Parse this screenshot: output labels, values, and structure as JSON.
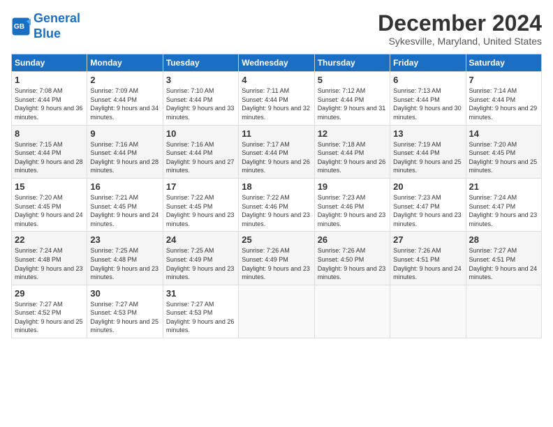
{
  "header": {
    "logo_line1": "General",
    "logo_line2": "Blue",
    "title": "December 2024",
    "subtitle": "Sykesville, Maryland, United States"
  },
  "columns": [
    "Sunday",
    "Monday",
    "Tuesday",
    "Wednesday",
    "Thursday",
    "Friday",
    "Saturday"
  ],
  "weeks": [
    [
      {
        "day": "1",
        "rise": "Sunrise: 7:08 AM",
        "set": "Sunset: 4:44 PM",
        "daylight": "Daylight: 9 hours and 36 minutes."
      },
      {
        "day": "2",
        "rise": "Sunrise: 7:09 AM",
        "set": "Sunset: 4:44 PM",
        "daylight": "Daylight: 9 hours and 34 minutes."
      },
      {
        "day": "3",
        "rise": "Sunrise: 7:10 AM",
        "set": "Sunset: 4:44 PM",
        "daylight": "Daylight: 9 hours and 33 minutes."
      },
      {
        "day": "4",
        "rise": "Sunrise: 7:11 AM",
        "set": "Sunset: 4:44 PM",
        "daylight": "Daylight: 9 hours and 32 minutes."
      },
      {
        "day": "5",
        "rise": "Sunrise: 7:12 AM",
        "set": "Sunset: 4:44 PM",
        "daylight": "Daylight: 9 hours and 31 minutes."
      },
      {
        "day": "6",
        "rise": "Sunrise: 7:13 AM",
        "set": "Sunset: 4:44 PM",
        "daylight": "Daylight: 9 hours and 30 minutes."
      },
      {
        "day": "7",
        "rise": "Sunrise: 7:14 AM",
        "set": "Sunset: 4:44 PM",
        "daylight": "Daylight: 9 hours and 29 minutes."
      }
    ],
    [
      {
        "day": "8",
        "rise": "Sunrise: 7:15 AM",
        "set": "Sunset: 4:44 PM",
        "daylight": "Daylight: 9 hours and 28 minutes."
      },
      {
        "day": "9",
        "rise": "Sunrise: 7:16 AM",
        "set": "Sunset: 4:44 PM",
        "daylight": "Daylight: 9 hours and 28 minutes."
      },
      {
        "day": "10",
        "rise": "Sunrise: 7:16 AM",
        "set": "Sunset: 4:44 PM",
        "daylight": "Daylight: 9 hours and 27 minutes."
      },
      {
        "day": "11",
        "rise": "Sunrise: 7:17 AM",
        "set": "Sunset: 4:44 PM",
        "daylight": "Daylight: 9 hours and 26 minutes."
      },
      {
        "day": "12",
        "rise": "Sunrise: 7:18 AM",
        "set": "Sunset: 4:44 PM",
        "daylight": "Daylight: 9 hours and 26 minutes."
      },
      {
        "day": "13",
        "rise": "Sunrise: 7:19 AM",
        "set": "Sunset: 4:44 PM",
        "daylight": "Daylight: 9 hours and 25 minutes."
      },
      {
        "day": "14",
        "rise": "Sunrise: 7:20 AM",
        "set": "Sunset: 4:45 PM",
        "daylight": "Daylight: 9 hours and 25 minutes."
      }
    ],
    [
      {
        "day": "15",
        "rise": "Sunrise: 7:20 AM",
        "set": "Sunset: 4:45 PM",
        "daylight": "Daylight: 9 hours and 24 minutes."
      },
      {
        "day": "16",
        "rise": "Sunrise: 7:21 AM",
        "set": "Sunset: 4:45 PM",
        "daylight": "Daylight: 9 hours and 24 minutes."
      },
      {
        "day": "17",
        "rise": "Sunrise: 7:22 AM",
        "set": "Sunset: 4:45 PM",
        "daylight": "Daylight: 9 hours and 23 minutes."
      },
      {
        "day": "18",
        "rise": "Sunrise: 7:22 AM",
        "set": "Sunset: 4:46 PM",
        "daylight": "Daylight: 9 hours and 23 minutes."
      },
      {
        "day": "19",
        "rise": "Sunrise: 7:23 AM",
        "set": "Sunset: 4:46 PM",
        "daylight": "Daylight: 9 hours and 23 minutes."
      },
      {
        "day": "20",
        "rise": "Sunrise: 7:23 AM",
        "set": "Sunset: 4:47 PM",
        "daylight": "Daylight: 9 hours and 23 minutes."
      },
      {
        "day": "21",
        "rise": "Sunrise: 7:24 AM",
        "set": "Sunset: 4:47 PM",
        "daylight": "Daylight: 9 hours and 23 minutes."
      }
    ],
    [
      {
        "day": "22",
        "rise": "Sunrise: 7:24 AM",
        "set": "Sunset: 4:48 PM",
        "daylight": "Daylight: 9 hours and 23 minutes."
      },
      {
        "day": "23",
        "rise": "Sunrise: 7:25 AM",
        "set": "Sunset: 4:48 PM",
        "daylight": "Daylight: 9 hours and 23 minutes."
      },
      {
        "day": "24",
        "rise": "Sunrise: 7:25 AM",
        "set": "Sunset: 4:49 PM",
        "daylight": "Daylight: 9 hours and 23 minutes."
      },
      {
        "day": "25",
        "rise": "Sunrise: 7:26 AM",
        "set": "Sunset: 4:49 PM",
        "daylight": "Daylight: 9 hours and 23 minutes."
      },
      {
        "day": "26",
        "rise": "Sunrise: 7:26 AM",
        "set": "Sunset: 4:50 PM",
        "daylight": "Daylight: 9 hours and 23 minutes."
      },
      {
        "day": "27",
        "rise": "Sunrise: 7:26 AM",
        "set": "Sunset: 4:51 PM",
        "daylight": "Daylight: 9 hours and 24 minutes."
      },
      {
        "day": "28",
        "rise": "Sunrise: 7:27 AM",
        "set": "Sunset: 4:51 PM",
        "daylight": "Daylight: 9 hours and 24 minutes."
      }
    ],
    [
      {
        "day": "29",
        "rise": "Sunrise: 7:27 AM",
        "set": "Sunset: 4:52 PM",
        "daylight": "Daylight: 9 hours and 25 minutes."
      },
      {
        "day": "30",
        "rise": "Sunrise: 7:27 AM",
        "set": "Sunset: 4:53 PM",
        "daylight": "Daylight: 9 hours and 25 minutes."
      },
      {
        "day": "31",
        "rise": "Sunrise: 7:27 AM",
        "set": "Sunset: 4:53 PM",
        "daylight": "Daylight: 9 hours and 26 minutes."
      },
      {
        "day": "",
        "rise": "",
        "set": "",
        "daylight": ""
      },
      {
        "day": "",
        "rise": "",
        "set": "",
        "daylight": ""
      },
      {
        "day": "",
        "rise": "",
        "set": "",
        "daylight": ""
      },
      {
        "day": "",
        "rise": "",
        "set": "",
        "daylight": ""
      }
    ]
  ]
}
